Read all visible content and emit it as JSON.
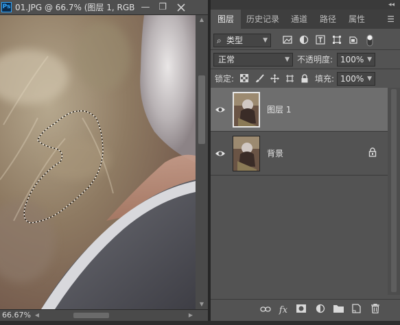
{
  "document": {
    "app_badge": "Ps",
    "title": "01.JPG @ 66.7% (图层 1, RGB...",
    "minimize_label": "—",
    "restore_label": "❐",
    "zoom": "66.67%"
  },
  "panel": {
    "tabs": [
      {
        "label": "图层",
        "active": true
      },
      {
        "label": "历史记录",
        "active": false
      },
      {
        "label": "通道",
        "active": false
      },
      {
        "label": "路径",
        "active": false
      },
      {
        "label": "属性",
        "active": false
      }
    ],
    "filter": {
      "search_glyph": "⌕",
      "kind_label": "类型"
    },
    "blend_mode": "正常",
    "opacity": {
      "label": "不透明度:",
      "value": "100%"
    },
    "lock": {
      "label": "锁定:"
    },
    "fill": {
      "label": "填充:",
      "value": "100%"
    },
    "layers": [
      {
        "name": "图层 1",
        "visible": true,
        "selected": true,
        "locked": false
      },
      {
        "name": "背景",
        "visible": true,
        "selected": false,
        "locked": true
      }
    ],
    "bottom_bar": {
      "fx_label": "fx"
    }
  },
  "icons": [
    "ps-app-icon",
    "minimize-icon",
    "restore-icon",
    "eye-icon",
    "lock-icon",
    "link-icon",
    "fx-icon",
    "mask-icon",
    "adjustment-icon",
    "folder-icon",
    "new-layer-icon",
    "trash-icon",
    "panel-menu-icon",
    "collapse-icon"
  ],
  "colors": {
    "accent_ps": "#31a8ff",
    "panel_bg": "#535353",
    "selected_layer": "#6e6e6e"
  }
}
